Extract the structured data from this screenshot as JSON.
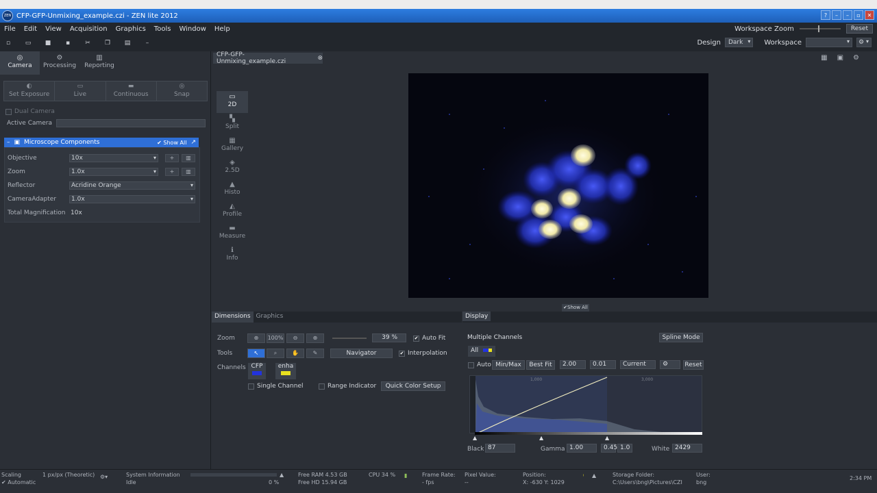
{
  "window": {
    "title": "CFP-GFP-Unmixing_example.czi - ZEN lite 2012",
    "logo": "ZEN",
    "controls": [
      "?",
      "–",
      "–",
      "▫",
      "✕"
    ]
  },
  "menu": [
    "File",
    "Edit",
    "View",
    "Acquisition",
    "Graphics",
    "Tools",
    "Window",
    "Help"
  ],
  "workspace": {
    "zoom_label": "Workspace Zoom",
    "reset_label": "Reset",
    "design_label": "Design",
    "design_value": "Dark",
    "workspace_label": "Workspace"
  },
  "left_tabs": [
    {
      "label": "Camera",
      "icon": "camera-icon"
    },
    {
      "label": "Processing",
      "icon": "gear-icon"
    },
    {
      "label": "Reporting",
      "icon": "chart-icon"
    }
  ],
  "camera_buttons": [
    "Set Exposure",
    "Live",
    "Continuous",
    "Snap"
  ],
  "dual_camera_label": "Dual Camera",
  "active_camera_label": "Active Camera",
  "microscope": {
    "header": "Microscope Components",
    "show_all": "Show All",
    "rows": [
      {
        "label": "Objective",
        "value": "10x"
      },
      {
        "label": "Zoom",
        "value": "1.0x"
      },
      {
        "label": "Reflector",
        "value": "Acridine Orange"
      },
      {
        "label": "CameraAdapter",
        "value": "1.0x"
      },
      {
        "label": "Total Magnification",
        "value": "10x"
      }
    ]
  },
  "document": {
    "tab_title": "CFP-GFP-Unmixing_example.czi"
  },
  "views": [
    "2D",
    "Split",
    "Gallery",
    "2.5D",
    "Histo",
    "Profile",
    "Measure",
    "Info"
  ],
  "show_all": "Show All",
  "dimensions": {
    "tab_dimensions": "Dimensions",
    "tab_graphics": "Graphics",
    "zoom_label": "Zoom",
    "zoom_percent": "39 %",
    "zoom_100": "100%",
    "auto_fit": "Auto Fit",
    "tools_label": "Tools",
    "navigator": "Navigator",
    "interpolation": "Interpolation",
    "channels_label": "Channels",
    "channel_1": "CFP",
    "channel_2": "enha",
    "single_channel": "Single Channel",
    "range_indicator": "Range Indicator",
    "quick_color_setup": "Quick Color Setup"
  },
  "display": {
    "tab": "Display",
    "multiple_channels": "Multiple Channels",
    "spline_mode": "Spline Mode",
    "all": "All",
    "auto": "Auto",
    "minmax": "Min/Max",
    "bestfit": "Best Fit",
    "value_1": "2.00",
    "value_2": "0.01",
    "current": "Current",
    "reset": "Reset",
    "black_label": "Black",
    "black_value": "87",
    "gamma_label": "Gamma",
    "gamma_value": "1.00",
    "gamma_a": "0.45",
    "gamma_b": "1.0",
    "white_label": "White",
    "white_value": "2429",
    "hist_ticks": [
      "1,000",
      "3,000"
    ]
  },
  "status": {
    "scaling_label": "Scaling",
    "scaling_value": "1 px/px (Theoretic)",
    "automatic": "Automatic",
    "sysinfo_label": "System Information",
    "sysinfo_value": "Idle",
    "progress": "0 %",
    "progress_fraction": 0.0,
    "free_ram": "Free RAM 4.53 GB",
    "free_hd": "Free HD   15.94 GB",
    "cpu": "CPU 34 %",
    "frame_rate_label": "Frame Rate:",
    "frame_rate_value": "- fps",
    "pixel_value_label": "Pixel Value:",
    "pixel_value": "--",
    "position_label": "Position:",
    "position_value": "X: -630  Y: 1029",
    "storage_label": "Storage Folder:",
    "storage_value": "C:\\Users\\bng\\Pictures\\CZI",
    "user_label": "User:",
    "user_value": "bng",
    "time": "2:34 PM"
  },
  "colors": {
    "accent": "#2f6fd6",
    "titlebar": "#1e5fb8",
    "background": "#2b2f36",
    "cfp": "#2233dd",
    "gfp": "#e8e020"
  }
}
